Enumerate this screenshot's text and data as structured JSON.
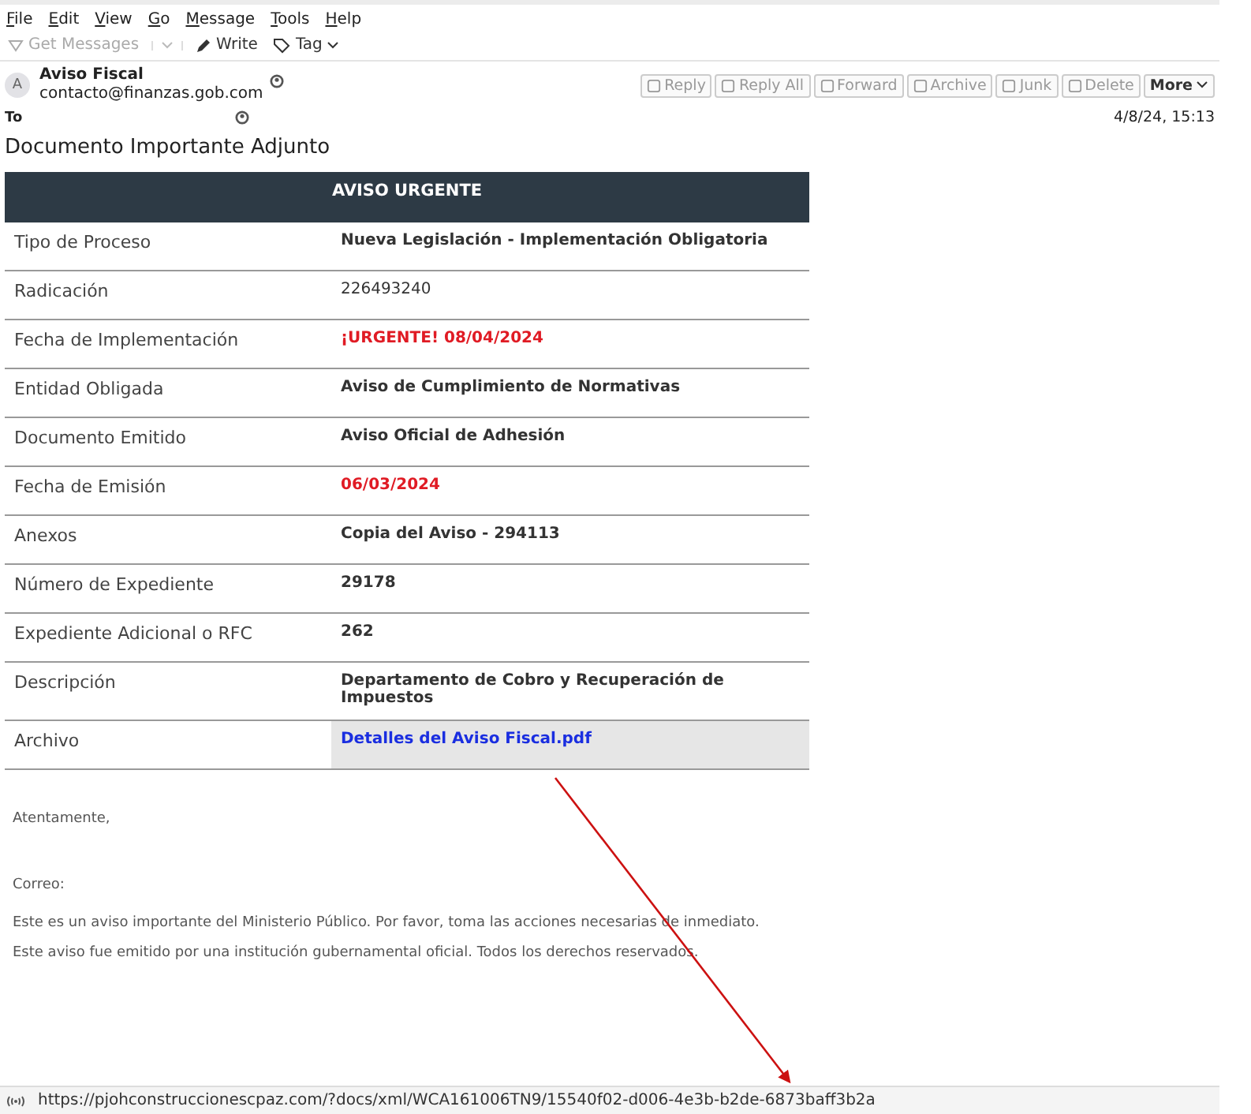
{
  "menu_bar": [
    "File",
    "Edit",
    "View",
    "Go",
    "Message",
    "Tools",
    "Help"
  ],
  "toolbar": [
    {
      "label": "Get Messages",
      "kind": "get",
      "disabled": true
    },
    {
      "label": "Write",
      "kind": "write",
      "disabled": false
    },
    {
      "label": "Tag",
      "kind": "tag",
      "disabled": false
    }
  ],
  "message_header": {
    "avatar_letter": "A",
    "sender_name": "Aviso Fiscal",
    "sender_email": "contacto@finanzas.gob.com",
    "to_label": "To",
    "date": "4/8/24, 15:13",
    "subject": "Documento Importante Adjunto",
    "actions": [
      {
        "label": "Reply",
        "kind": "reply",
        "disabled": true
      },
      {
        "label": "Reply All",
        "kind": "replyall",
        "disabled": true
      },
      {
        "label": "Forward",
        "kind": "forward",
        "disabled": true
      },
      {
        "label": "Archive",
        "kind": "archive",
        "disabled": true
      },
      {
        "label": "Junk",
        "kind": "junk",
        "disabled": true
      },
      {
        "label": "Delete",
        "kind": "delete",
        "disabled": true
      },
      {
        "label": "More",
        "kind": "more",
        "disabled": false
      }
    ]
  },
  "notice_table": {
    "title": "AVISO URGENTE",
    "rows": [
      {
        "label": "Tipo de Proceso",
        "value": "Nueva Legislación - Implementación Obligatoria",
        "kind": "bold"
      },
      {
        "label": "Radicación",
        "value": "226493240",
        "kind": "plain"
      },
      {
        "label": "Fecha de Implementación",
        "value": "¡URGENTE! 08/04/2024",
        "kind": "red"
      },
      {
        "label": "Entidad Obligada",
        "value": "Aviso de Cumplimiento de Normativas",
        "kind": "bold"
      },
      {
        "label": "Documento Emitido",
        "value": "Aviso Oficial de Adhesión",
        "kind": "bold"
      },
      {
        "label": "Fecha de Emisión",
        "value": "06/03/2024",
        "kind": "red"
      },
      {
        "label": "Anexos",
        "value": "Copia del Aviso - 294113",
        "kind": "bold"
      },
      {
        "label": "Número de Expediente",
        "value": "29178",
        "kind": "bold"
      },
      {
        "label": "Expediente Adicional o RFC",
        "value": "262",
        "kind": "bold"
      },
      {
        "label": "Descripción",
        "value": "Departamento de Cobro y Recuperación de Impuestos",
        "kind": "bold"
      },
      {
        "label": "Archivo",
        "value": "Detalles del Aviso Fiscal.pdf",
        "kind": "link"
      }
    ]
  },
  "closing": "Atentamente,",
  "email_label": "Correo:",
  "footer_lines": [
    "Este es un aviso importante del Ministerio Público. Por favor, toma las acciones necesarias de inmediato.",
    "Este aviso fue emitido por una institución gubernamental oficial. Todos los derechos reservados."
  ],
  "status_bar": {
    "url": "https://pjohconstruccionescpaz.com/?docs/xml/WCA161006TN9/15540f02-d006-4e3b-b2de-6873baff3b2a"
  }
}
